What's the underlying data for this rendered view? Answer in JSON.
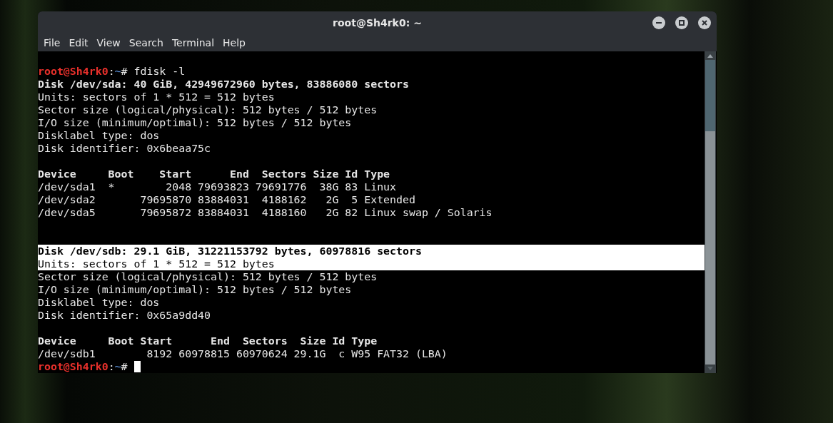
{
  "window": {
    "title": "root@Sh4rk0: ~"
  },
  "menu": [
    "File",
    "Edit",
    "View",
    "Search",
    "Terminal",
    "Help"
  ],
  "lines": [
    {
      "kind": "prompt",
      "user": "root@Sh4rk0",
      "sep": ":",
      "path": "~",
      "symbol": "#",
      "command": " fdisk -l",
      "cursor": false
    },
    {
      "kind": "bold",
      "text": "Disk /dev/sda: 40 GiB, 42949672960 bytes, 83886080 sectors",
      "highlighted": false
    },
    {
      "kind": "normal",
      "text": "Units: sectors of 1 * 512 = 512 bytes",
      "highlighted": false
    },
    {
      "kind": "normal",
      "text": "Sector size (logical/physical): 512 bytes / 512 bytes",
      "highlighted": false
    },
    {
      "kind": "normal",
      "text": "I/O size (minimum/optimal): 512 bytes / 512 bytes",
      "highlighted": false
    },
    {
      "kind": "normal",
      "text": "Disklabel type: dos",
      "highlighted": false
    },
    {
      "kind": "normal",
      "text": "Disk identifier: 0x6beaa75c",
      "highlighted": false
    },
    {
      "kind": "blank"
    },
    {
      "kind": "bold",
      "text": "Device     Boot    Start      End  Sectors Size Id Type",
      "highlighted": false
    },
    {
      "kind": "normal",
      "text": "/dev/sda1  *        2048 79693823 79691776  38G 83 Linux",
      "highlighted": false
    },
    {
      "kind": "normal",
      "text": "/dev/sda2       79695870 83884031  4188162   2G  5 Extended",
      "highlighted": false
    },
    {
      "kind": "normal",
      "text": "/dev/sda5       79695872 83884031  4188160   2G 82 Linux swap / Solaris",
      "highlighted": false
    },
    {
      "kind": "blank"
    },
    {
      "kind": "blank"
    },
    {
      "kind": "bold",
      "text": "Disk /dev/sdb: 29.1 GiB, 31221153792 bytes, 60978816 sectors",
      "highlighted": true
    },
    {
      "kind": "normal",
      "text": "Units: sectors of 1 * 512 = 512 bytes",
      "highlighted": true
    },
    {
      "kind": "normal",
      "text": "Sector size (logical/physical): 512 bytes / 512 bytes",
      "highlighted": false
    },
    {
      "kind": "normal",
      "text": "I/O size (minimum/optimal): 512 bytes / 512 bytes",
      "highlighted": false
    },
    {
      "kind": "normal",
      "text": "Disklabel type: dos",
      "highlighted": false
    },
    {
      "kind": "normal",
      "text": "Disk identifier: 0x65a9dd40",
      "highlighted": false
    },
    {
      "kind": "blank"
    },
    {
      "kind": "bold",
      "text": "Device     Boot Start      End  Sectors  Size Id Type",
      "highlighted": false
    },
    {
      "kind": "normal",
      "text": "/dev/sdb1        8192 60978815 60970624 29.1G  c W95 FAT32 (LBA)",
      "highlighted": false
    },
    {
      "kind": "prompt",
      "user": "root@Sh4rk0",
      "sep": ":",
      "path": "~",
      "symbol": "#",
      "cursor": true
    }
  ]
}
